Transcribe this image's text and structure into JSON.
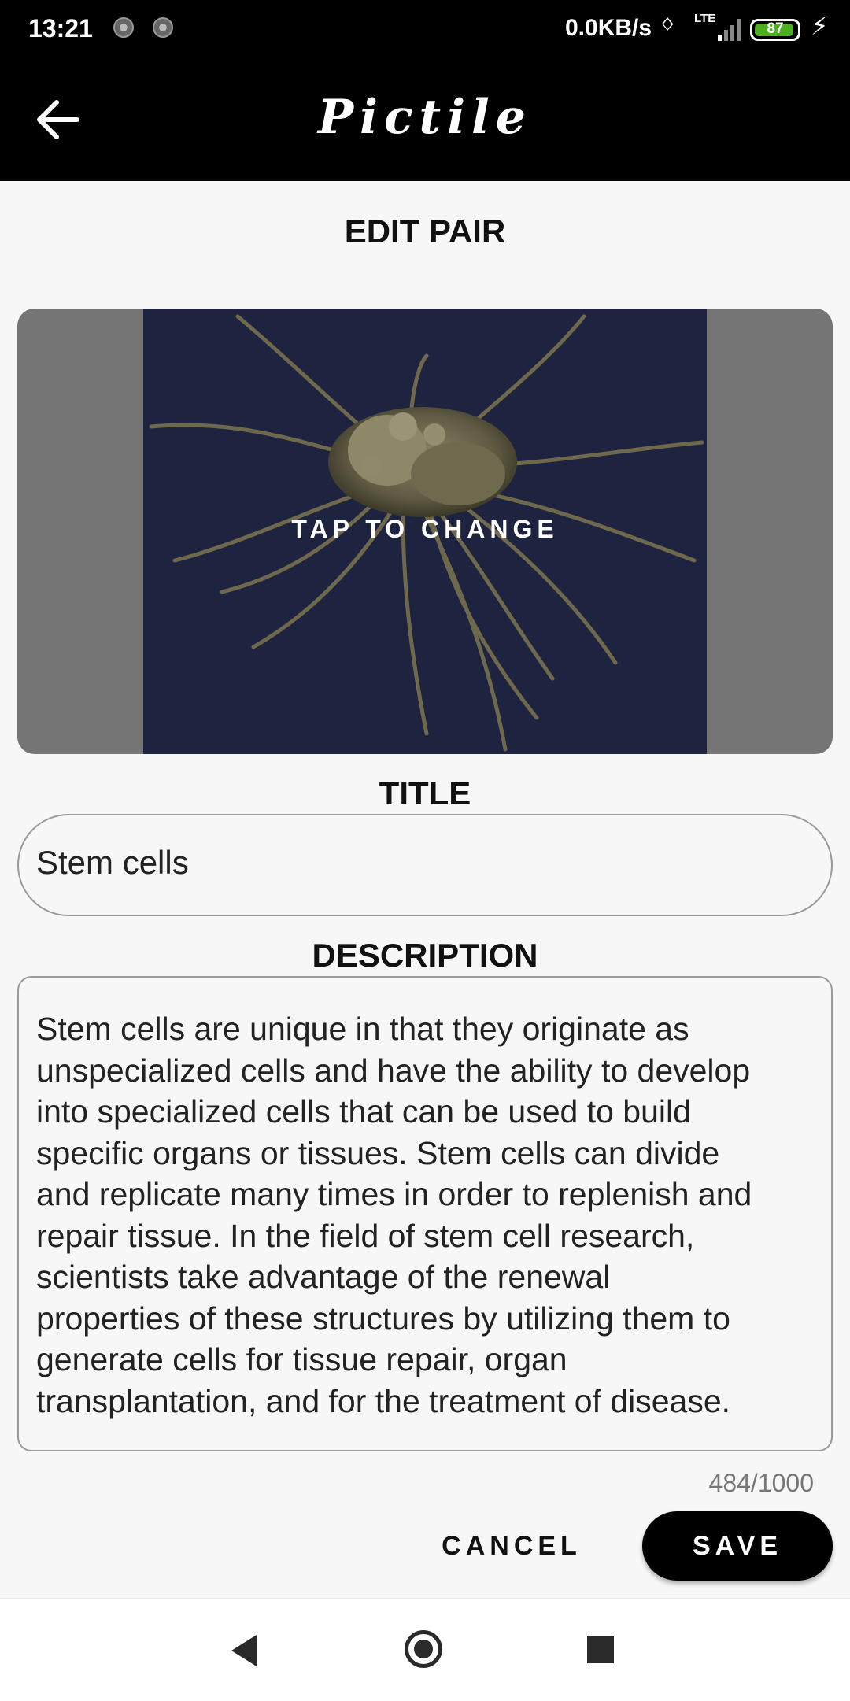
{
  "status": {
    "time": "13:21",
    "network_speed": "0.0KB/s",
    "network_type": "LTE",
    "battery_level": "87"
  },
  "appbar": {
    "title": "Pictile",
    "back_icon": "arrow-left-icon"
  },
  "page": {
    "heading": "EDIT PAIR"
  },
  "image": {
    "overlay_label": "TAP TO CHANGE"
  },
  "form": {
    "title_label": "TITLE",
    "title_value": "Stem cells",
    "description_label": "DESCRIPTION",
    "description_value": "Stem cells are unique in that they originate as\nunspecialized cells and have the ability to develop\ninto specialized cells that can be used to build\nspecific organs or tissues. Stem cells can divide\nand replicate many times in order to replenish and\nrepair tissue. In the field of stem cell research,\nscientists take advantage of the renewal\nproperties of these structures by utilizing them to\ngenerate cells for tissue repair, organ\ntransplantation, and for the treatment of disease.",
    "char_count": "484/1000"
  },
  "actions": {
    "cancel_label": "CANCEL",
    "save_label": "SAVE"
  },
  "colors": {
    "appbar": "#000000",
    "background": "#f7f7f7",
    "image_frame": "#757575",
    "photo_bg": "#1e2340"
  }
}
